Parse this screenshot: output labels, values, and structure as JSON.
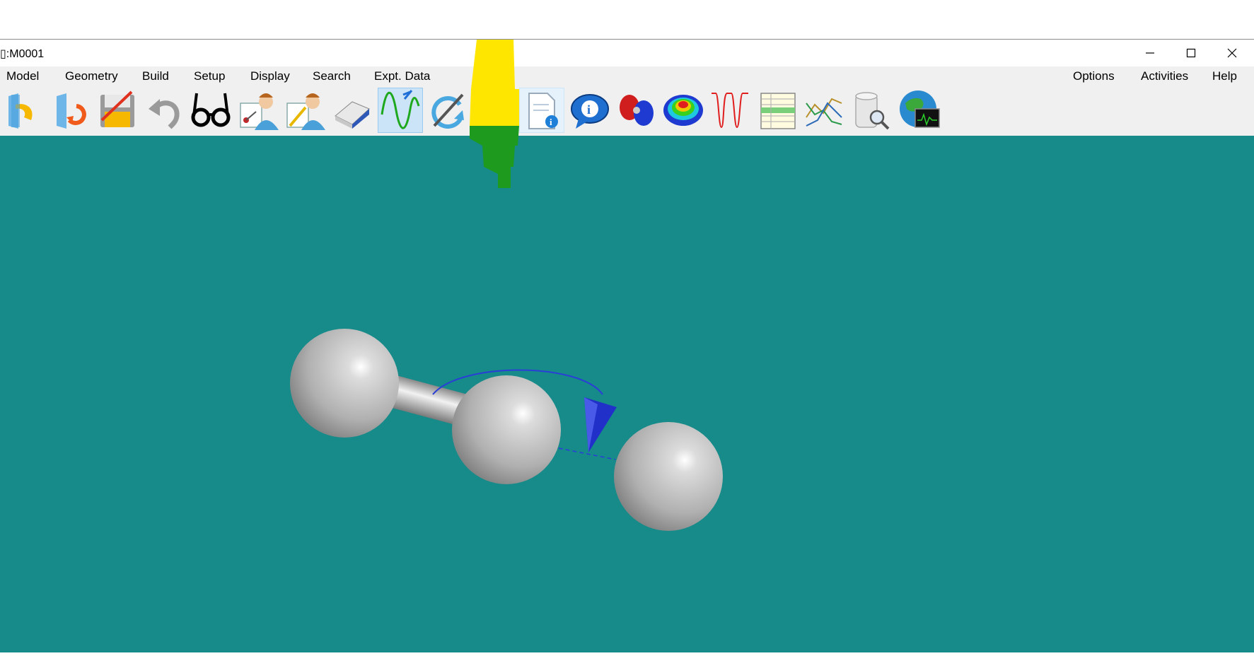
{
  "window": {
    "title": "▯:M0001",
    "controls": {
      "minimize": "minimize",
      "maximize": "maximize",
      "close": "close"
    }
  },
  "menus": {
    "left": [
      "Model",
      "Geometry",
      "Build",
      "Setup",
      "Display",
      "Search",
      "Expt. Data"
    ],
    "right": [
      "Options",
      "Activities",
      "Help"
    ]
  },
  "toolbar": {
    "buttons": [
      {
        "icon": "open-file-icon"
      },
      {
        "icon": "recent-files-icon"
      },
      {
        "icon": "save-icon"
      },
      {
        "icon": "undo-icon"
      },
      {
        "icon": "view-glasses-icon"
      },
      {
        "icon": "build-molecule-icon"
      },
      {
        "icon": "edit-molecule-icon"
      },
      {
        "icon": "eraser-icon"
      },
      {
        "icon": "wave-function-icon",
        "state": "active"
      },
      {
        "icon": "refresh-icon"
      },
      {
        "icon": "calculation-setup-icon"
      },
      {
        "icon": "document-info-icon",
        "state": "hover"
      },
      {
        "icon": "info-bubble-icon"
      },
      {
        "icon": "orbital-icon"
      },
      {
        "icon": "potential-surface-icon"
      },
      {
        "icon": "spectrum-icon"
      },
      {
        "icon": "spreadsheet-icon"
      },
      {
        "icon": "plot-icon"
      },
      {
        "icon": "database-search-icon"
      },
      {
        "icon": "globe-monitor-icon"
      }
    ]
  },
  "scene": {
    "background": "#178a8a",
    "atoms": [
      {
        "element": "H",
        "color": "#c8c8c8"
      },
      {
        "element": "H",
        "color": "#c8c8c8"
      },
      {
        "element": "H",
        "color": "#c8c8c8"
      }
    ],
    "annotation_color": "#2a3fd6"
  },
  "colors": {
    "highlight_yellow": "#ffe600",
    "highlight_green": "#1e9a1e"
  }
}
